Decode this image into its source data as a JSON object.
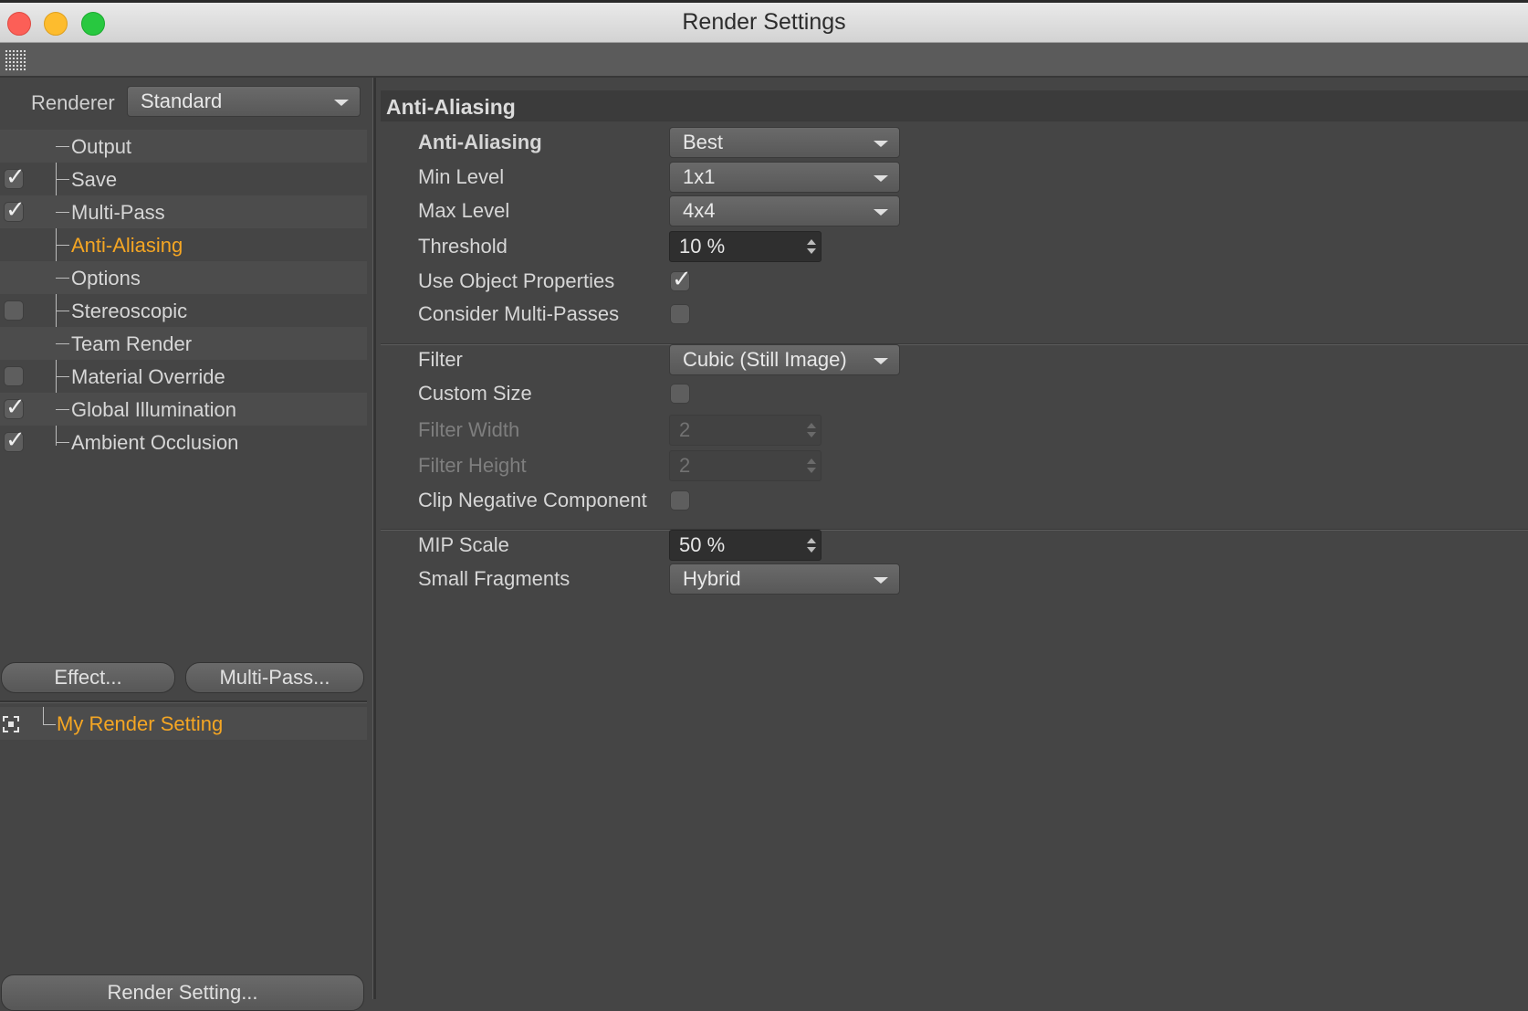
{
  "window": {
    "title": "Render Settings"
  },
  "left": {
    "renderer_label": "Renderer",
    "renderer_value": "Standard",
    "tree": [
      {
        "label": "Output",
        "checkbox": "none",
        "active": false
      },
      {
        "label": "Save",
        "checkbox": "checked",
        "active": false
      },
      {
        "label": "Multi-Pass",
        "checkbox": "checked",
        "active": false
      },
      {
        "label": "Anti-Aliasing",
        "checkbox": "none",
        "active": true
      },
      {
        "label": "Options",
        "checkbox": "none",
        "active": false
      },
      {
        "label": "Stereoscopic",
        "checkbox": "unchecked",
        "active": false
      },
      {
        "label": "Team Render",
        "checkbox": "none",
        "active": false
      },
      {
        "label": "Material Override",
        "checkbox": "unchecked",
        "active": false
      },
      {
        "label": "Global Illumination",
        "checkbox": "checked",
        "active": false
      },
      {
        "label": "Ambient Occlusion",
        "checkbox": "checked",
        "active": false
      }
    ],
    "effect_button": "Effect...",
    "multipass_button": "Multi-Pass...",
    "render_setting_name": "My Render Setting",
    "render_setting_button": "Render Setting..."
  },
  "panel": {
    "section_title": "Anti-Aliasing",
    "anti_aliasing": {
      "label": "Anti-Aliasing",
      "value": "Best"
    },
    "min_level": {
      "label": "Min Level",
      "value": "1x1"
    },
    "max_level": {
      "label": "Max Level",
      "value": "4x4"
    },
    "threshold": {
      "label": "Threshold",
      "value": "10 %"
    },
    "use_object_properties": {
      "label": "Use Object Properties",
      "checked": true
    },
    "consider_multi_passes": {
      "label": "Consider Multi-Passes",
      "checked": false
    },
    "filter": {
      "label": "Filter",
      "value": "Cubic (Still Image)"
    },
    "custom_size": {
      "label": "Custom Size",
      "checked": false
    },
    "filter_width": {
      "label": "Filter Width",
      "value": "2"
    },
    "filter_height": {
      "label": "Filter Height",
      "value": "2"
    },
    "clip_negative_component": {
      "label": "Clip Negative Component",
      "checked": false
    },
    "mip_scale": {
      "label": "MIP Scale",
      "value": "50 %"
    },
    "small_fragments": {
      "label": "Small Fragments",
      "value": "Hybrid"
    }
  },
  "colors": {
    "accent": "#f5a623",
    "background": "#454545"
  },
  "icons": {
    "check_glyph": "✓"
  }
}
